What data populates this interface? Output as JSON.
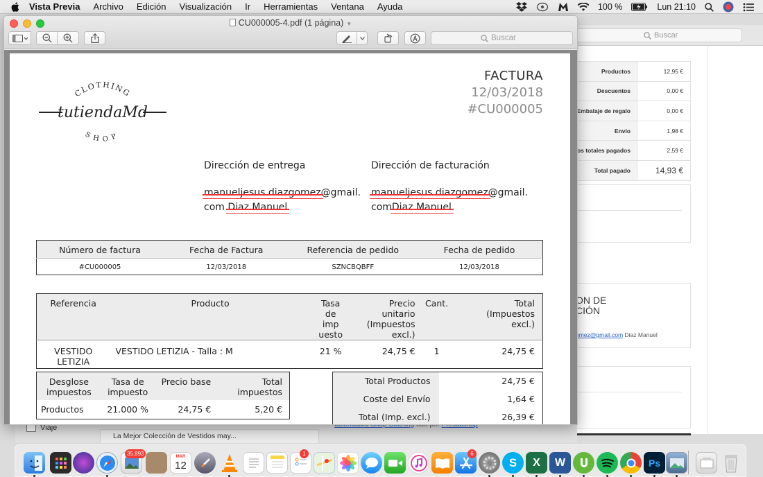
{
  "menubar": {
    "app_name": "Vista Previa",
    "menus": [
      "Archivo",
      "Edición",
      "Visualización",
      "Ir",
      "Herramientas",
      "Ventana",
      "Ayuda"
    ],
    "battery": "100 %",
    "clock": "Lun 21:10"
  },
  "preview_window": {
    "title": "CU000005-4.pdf (1 página)",
    "search_placeholder": "Buscar"
  },
  "invoice": {
    "logo_text": {
      "top": "CLOTHING",
      "main": "tutiendaMd",
      "bottom": "SHOP"
    },
    "heading": "FACTURA",
    "date": "12/03/2018",
    "number": "#CU000005",
    "shipping": {
      "title": "Dirección de entrega",
      "email_struck": "manueljesus.diazgomez",
      "email_rest": "@gmail.",
      "line2_prefix": "com",
      "name_struck": "Diaz Manuel"
    },
    "billing": {
      "title": "Dirección de facturación",
      "email_struck": "manueljesus.diazgomez",
      "email_rest": "@gmail.",
      "line2_prefix": "com",
      "name_struck": "Diaz Manuel"
    },
    "info_table": {
      "headers": [
        "Número de factura",
        "Fecha de Factura",
        "Referencia de pedido",
        "Fecha de pedido"
      ],
      "row": [
        "#CU000005",
        "12/03/2018",
        "SZNCBQBFF",
        "12/03/2018"
      ]
    },
    "items_table": {
      "headers": [
        "Referencia",
        "Producto",
        "Tasa de imp uesto",
        "Precio unitario (Impuestos excl.)",
        "Cant.",
        "Total (Impuestos excl.)"
      ],
      "rows": [
        [
          "VESTIDO LETIZIA",
          "VESTIDO LETIZIA - Talla : M",
          "21 %",
          "24,75 €",
          "1",
          "24,75 €"
        ]
      ]
    },
    "tax_table": {
      "headers": [
        "Desglose impuestos",
        "Tasa de impuesto",
        "Precio base",
        "Total impuestos"
      ],
      "rows": [
        [
          "Productos",
          "21.000 %",
          "24,75 €",
          "5,20 €"
        ]
      ]
    },
    "totals_table": {
      "rows": [
        [
          "Total Productos",
          "24,75 €"
        ],
        [
          "Coste del Envío",
          "1,64 €"
        ],
        [
          "Total (Imp. excl.)",
          "26,39 €"
        ]
      ]
    }
  },
  "background_window": {
    "search_placeholder": "Buscar",
    "summary": [
      [
        "Productos",
        "12,95 €"
      ],
      [
        "Descuentos",
        "0,00 €"
      ],
      [
        "Embalaje de regalo",
        "0,00 €"
      ],
      [
        "Envío",
        "1,98 €"
      ],
      [
        "os totales pagados",
        "2,59 €"
      ],
      [
        "Total pagado",
        "14,93 €"
      ]
    ],
    "section_heading_line1": "ON DE",
    "section_heading_line2": "CIÓN",
    "email_link": "omez@gmail.com",
    "email_name": "Diaz Manuel",
    "tab_label": "Viaje",
    "tab_snippet": "La Mejor Colección de Vestidos may...",
    "footer_text": "tutiendaMd Shop Clothing",
    "footer_mid": "odo por",
    "footer_link": "PrestaShop"
  },
  "dock": {
    "badges": {
      "photos": "35.893",
      "calendar_month": "MAR",
      "calendar_day": "12",
      "reminders": "1",
      "appstore": "6"
    },
    "app_letters": {
      "excel": "X",
      "word": "W",
      "photoshop": "Ps"
    }
  },
  "colors": {
    "strike_red": "#e33333",
    "traffic_red": "#fc5f57",
    "traffic_yellow": "#fdbc2e",
    "traffic_green": "#28c840",
    "link_blue": "#2a62c9"
  }
}
